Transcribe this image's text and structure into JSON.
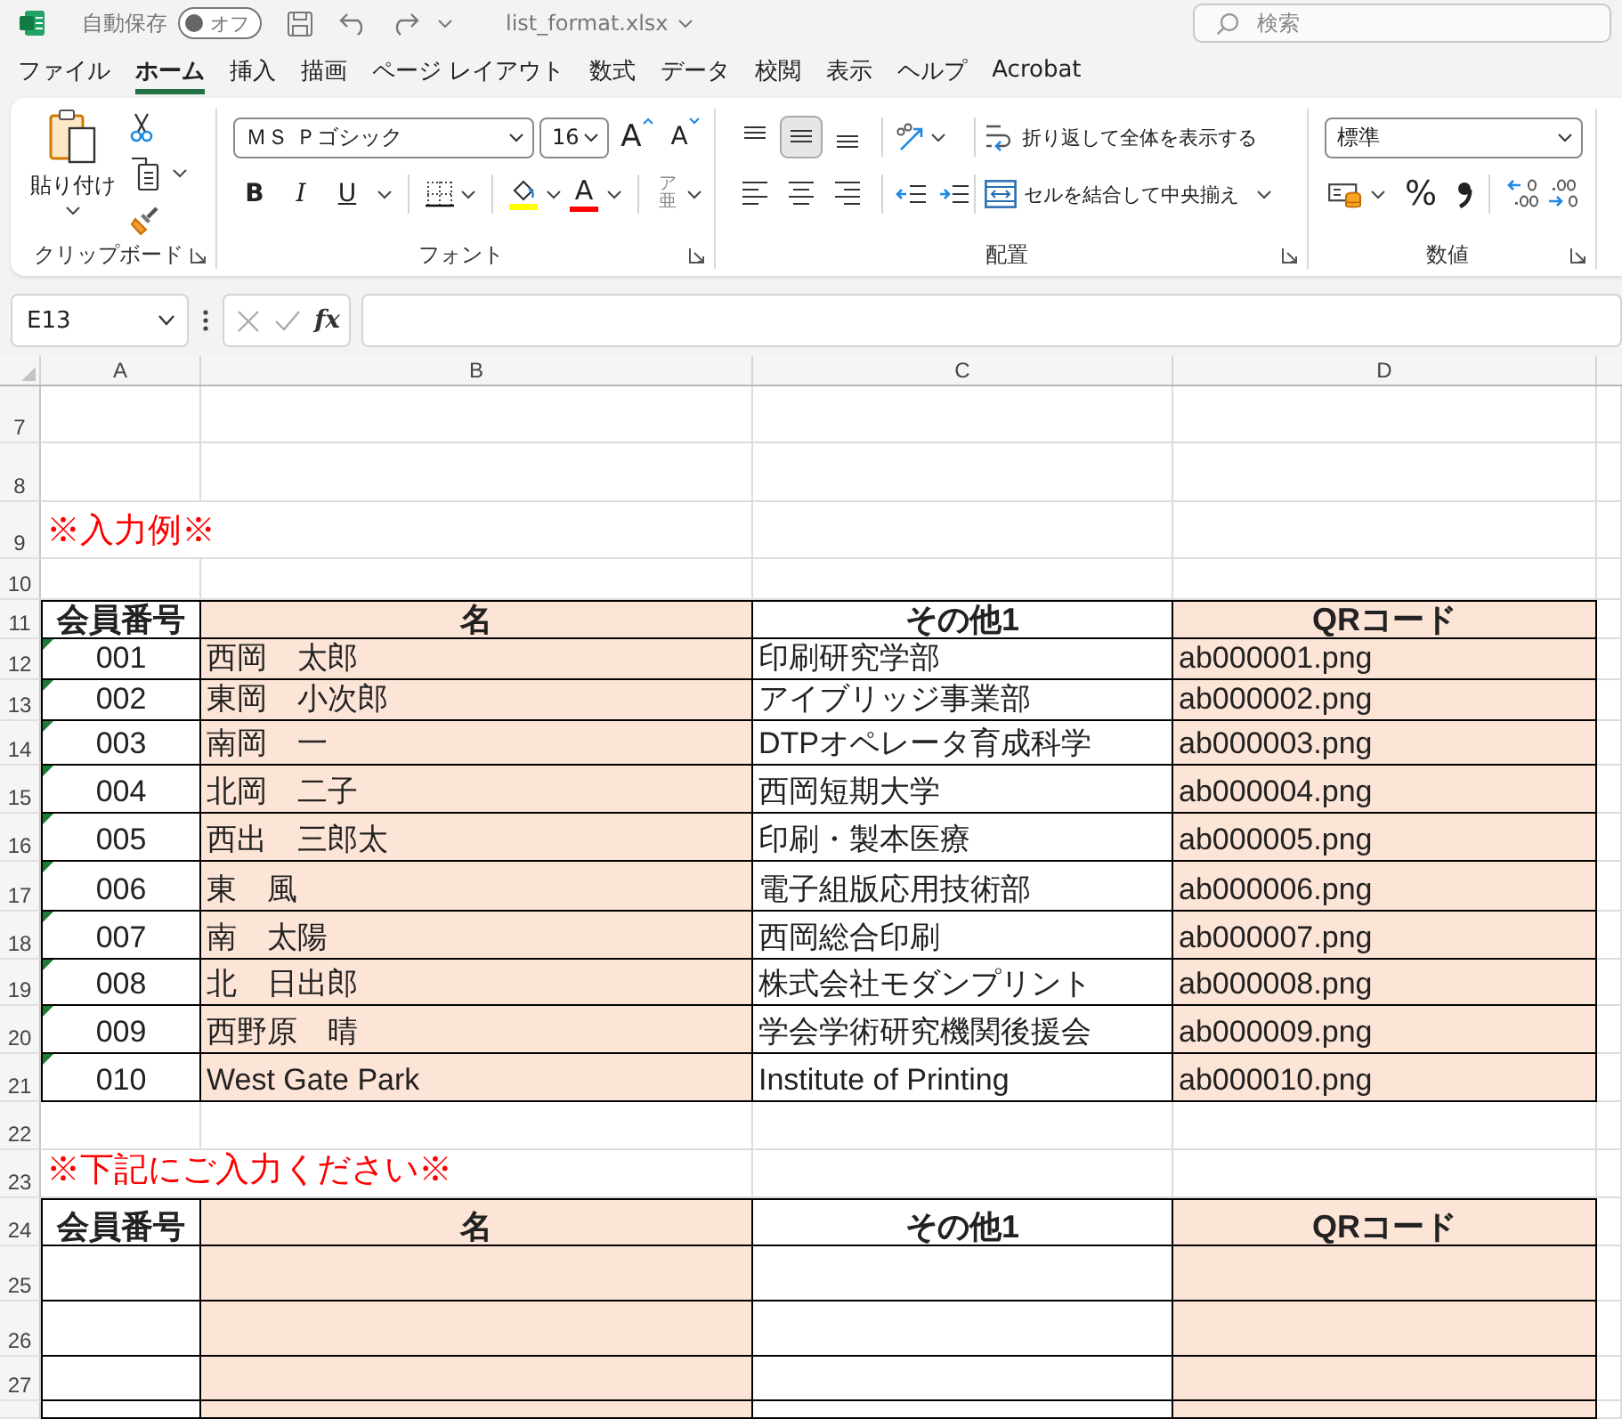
{
  "title_bar": {
    "autosave_label": "自動保存",
    "autosave": {
      "label": "オフ",
      "on": false
    },
    "file_name": "list_format.xlsx",
    "search": {
      "placeholder": "検索"
    }
  },
  "tabs": [
    {
      "label": "ファイル",
      "selected": false
    },
    {
      "label": "ホーム",
      "selected": true
    },
    {
      "label": "挿入",
      "selected": false
    },
    {
      "label": "描画",
      "selected": false
    },
    {
      "label": "ページ レイアウト",
      "selected": false
    },
    {
      "label": "数式",
      "selected": false
    },
    {
      "label": "データ",
      "selected": false
    },
    {
      "label": "校閲",
      "selected": false
    },
    {
      "label": "表示",
      "selected": false
    },
    {
      "label": "ヘルプ",
      "selected": false
    },
    {
      "label": "Acrobat",
      "selected": false
    }
  ],
  "ribbon": {
    "clipboard": {
      "label": "クリップボード",
      "paste_label": "貼り付け"
    },
    "font": {
      "label": "フォント",
      "font_name": "ＭＳ Ｐゴシック",
      "font_size": "16",
      "grow_glyph": "A",
      "shrink_glyph": "A",
      "style_buttons": [
        {
          "kind": "bold",
          "glyph": "B"
        },
        {
          "kind": "italic",
          "glyph": "I"
        },
        {
          "kind": "underline",
          "glyph": "U"
        }
      ],
      "font_color_glyph": "A",
      "phonetic_glyphs": [
        "ア",
        "亜"
      ]
    },
    "alignment": {
      "label": "配置",
      "vertical": [
        {
          "kind": "top",
          "selected": false
        },
        {
          "kind": "middle",
          "selected": true
        },
        {
          "kind": "bottom",
          "selected": false
        }
      ],
      "horizontal": [
        {
          "kind": "left",
          "selected": false
        },
        {
          "kind": "center",
          "selected": false
        },
        {
          "kind": "right",
          "selected": false
        }
      ],
      "wrap_text": "折り返して全体を表示する",
      "merge_center": "セルを結合して中央揃え"
    },
    "number": {
      "label": "数値",
      "format": "標準",
      "percent_glyph": "%"
    }
  },
  "formula_bar": {
    "name_box": "E13",
    "insert_function_glyph": "fx"
  },
  "sheet": {
    "columns": [
      {
        "letter": "A",
        "shaded": false
      },
      {
        "letter": "B",
        "shaded": true
      },
      {
        "letter": "C",
        "shaded": false
      },
      {
        "letter": "D",
        "shaded": true
      }
    ],
    "rows": [
      {
        "number": "7",
        "kind": "blank"
      },
      {
        "number": "8",
        "kind": "blank"
      },
      {
        "number": "9",
        "kind": "caption",
        "text": "※入力例※"
      },
      {
        "number": "10",
        "kind": "blank"
      },
      {
        "number": "11",
        "kind": "header",
        "cells": [
          "会員番号",
          "名",
          "その他1",
          "QRコード"
        ]
      },
      {
        "number": "12",
        "kind": "data",
        "flagged": true,
        "cells": [
          "001",
          "西岡　太郎",
          "印刷研究学部",
          "ab000001.png"
        ]
      },
      {
        "number": "13",
        "kind": "data",
        "flagged": true,
        "cells": [
          "002",
          "東岡　小次郎",
          "アイブリッジ事業部",
          "ab000002.png"
        ]
      },
      {
        "number": "14",
        "kind": "data",
        "flagged": true,
        "cells": [
          "003",
          "南岡　一",
          "DTPオペレータ育成科学",
          "ab000003.png"
        ]
      },
      {
        "number": "15",
        "kind": "data",
        "flagged": true,
        "cells": [
          "004",
          "北岡　二子",
          "西岡短期大学",
          "ab000004.png"
        ]
      },
      {
        "number": "16",
        "kind": "data",
        "flagged": true,
        "cells": [
          "005",
          "西出　三郎太",
          "印刷・製本医療",
          "ab000005.png"
        ]
      },
      {
        "number": "17",
        "kind": "data",
        "flagged": true,
        "cells": [
          "006",
          "東　風",
          "電子組版応用技術部",
          "ab000006.png"
        ]
      },
      {
        "number": "18",
        "kind": "data",
        "flagged": true,
        "cells": [
          "007",
          "南　太陽",
          "西岡総合印刷",
          "ab000007.png"
        ]
      },
      {
        "number": "19",
        "kind": "data",
        "flagged": true,
        "cells": [
          "008",
          "北　日出郎",
          "株式会社モダンプリント",
          "ab000008.png"
        ]
      },
      {
        "number": "20",
        "kind": "data",
        "flagged": true,
        "cells": [
          "009",
          "西野原　晴",
          "学会学術研究機関後援会",
          "ab000009.png"
        ]
      },
      {
        "number": "21",
        "kind": "data",
        "flagged": true,
        "cells": [
          "010",
          "West Gate Park",
          "Institute of Printing",
          "ab000010.png"
        ]
      },
      {
        "number": "22",
        "kind": "blank"
      },
      {
        "number": "23",
        "kind": "caption",
        "text": "※下記にご入力ください※"
      },
      {
        "number": "24",
        "kind": "header",
        "cells": [
          "会員番号",
          "名",
          "その他1",
          "QRコード"
        ]
      },
      {
        "number": "25",
        "kind": "entry"
      },
      {
        "number": "26",
        "kind": "entry"
      },
      {
        "number": "27",
        "kind": "entry"
      },
      {
        "kind": "entry"
      }
    ]
  }
}
